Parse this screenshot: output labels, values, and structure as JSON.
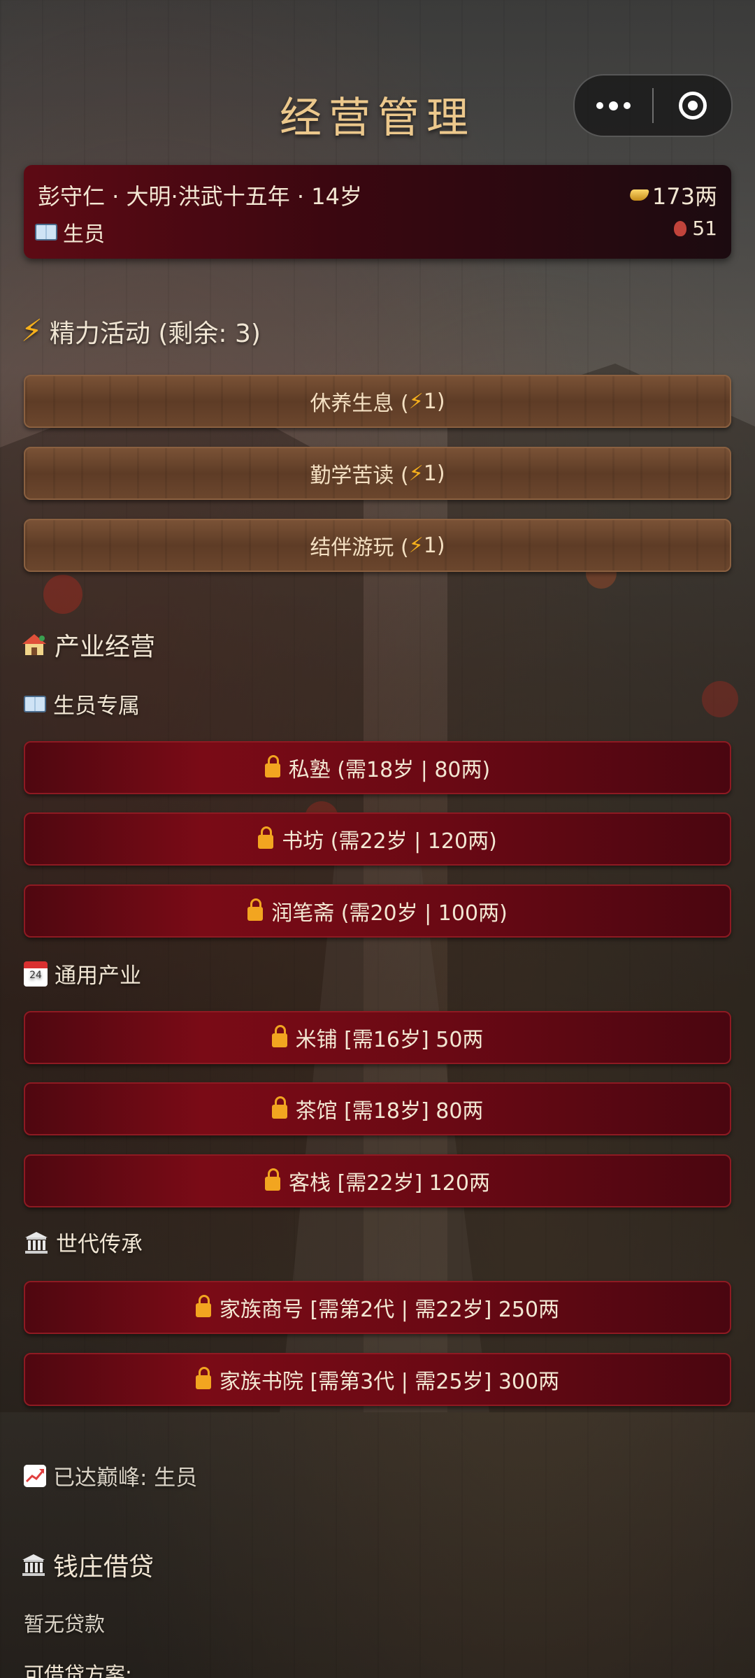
{
  "header": {
    "title": "经营管理"
  },
  "capsule": {
    "more_icon": "more-dots-icon",
    "close_icon": "target-circle-icon"
  },
  "status": {
    "name_line": "彭守仁 · 大明·洪武十五年 · 14岁",
    "rank": "生员",
    "money": "173两",
    "extra": "51"
  },
  "energy": {
    "heading": "精力活动 (剩余: 3)",
    "actions": [
      {
        "label": "休养生息 (",
        "cost": "1)"
      },
      {
        "label": "勤学苦读 (",
        "cost": "1)"
      },
      {
        "label": "结伴游玩 (",
        "cost": "1)"
      }
    ]
  },
  "industry": {
    "heading": "产业经营",
    "scholar": {
      "heading": "生员专属",
      "items": [
        "私塾 (需18岁 | 80两)",
        "书坊 (需22岁 | 120两)",
        "润笔斋 (需20岁 | 100两)"
      ]
    },
    "general": {
      "heading": "通用产业",
      "calendar_number": "24",
      "items": [
        "米铺 [需16岁] 50两",
        "茶馆 [需18岁] 80两",
        "客栈 [需22岁] 120两"
      ]
    },
    "legacy": {
      "heading": "世代传承",
      "items": [
        "家族商号 [需第2代 | 需22岁] 250两",
        "家族书院 [需第3代 | 需25岁] 300两"
      ]
    }
  },
  "peak": {
    "text": "已达巅峰: 生员"
  },
  "loan": {
    "heading": "钱庄借贷",
    "status": "暂无贷款",
    "plans_label": "可借贷方案:"
  },
  "colors": {
    "title": "#ecc88c",
    "accent_bolt": "#f6b01c",
    "lock": "#f2a520",
    "button_red": "#7a0b16",
    "button_wood": "#6b462d"
  }
}
